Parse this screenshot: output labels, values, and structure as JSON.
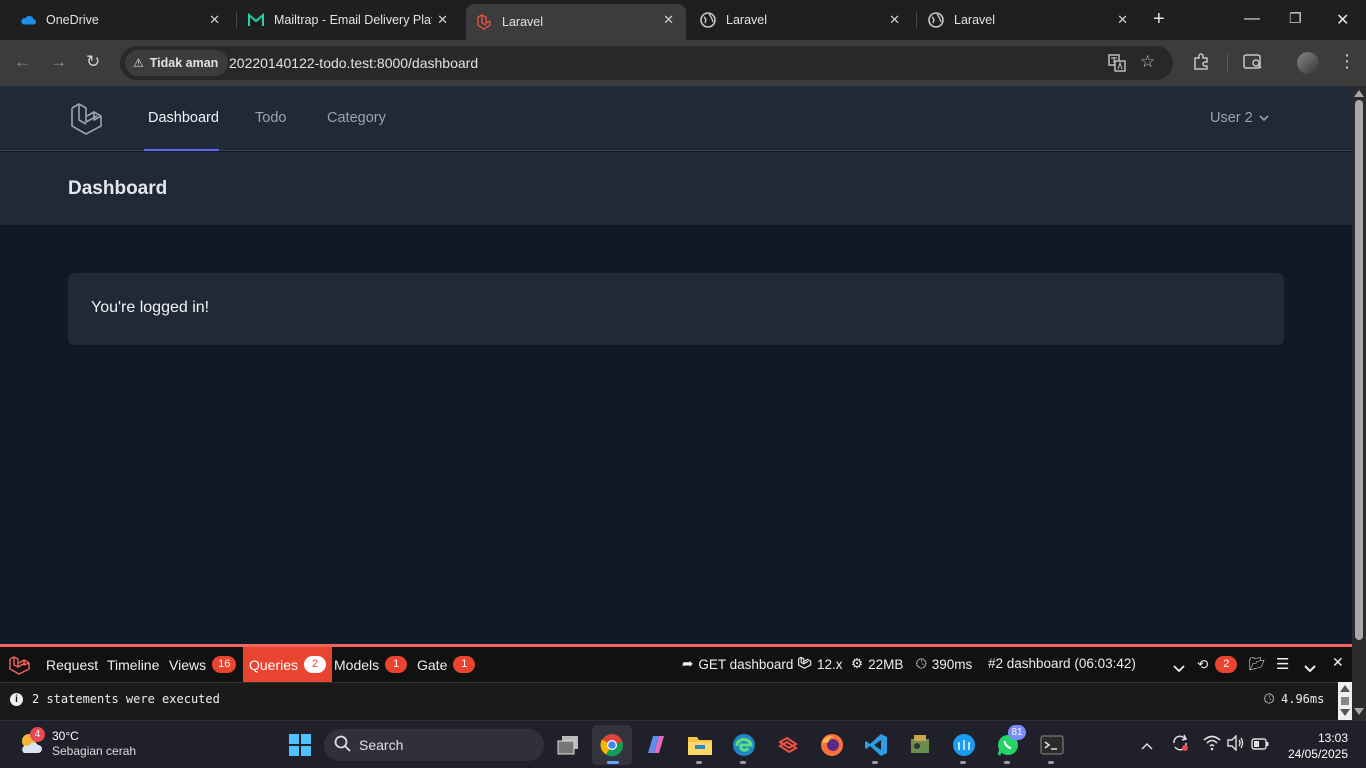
{
  "browser": {
    "tabs": [
      {
        "title": "OneDrive",
        "icon": "onedrive-icon"
      },
      {
        "title": "Mailtrap - Email Delivery Platf",
        "icon": "mailtrap-icon"
      },
      {
        "title": "Laravel",
        "icon": "laravel-icon",
        "active": true
      },
      {
        "title": "Laravel",
        "icon": "globe-icon"
      },
      {
        "title": "Laravel",
        "icon": "globe-icon"
      }
    ],
    "security_label": "Tidak aman",
    "url": "20220140122-todo.test:8000/dashboard"
  },
  "app": {
    "nav": {
      "dashboard": "Dashboard",
      "todo": "Todo",
      "category": "Category"
    },
    "user_menu": "User 2",
    "page_title": "Dashboard",
    "card_text": "You're logged in!"
  },
  "debugbar": {
    "tabs": {
      "request": "Request",
      "timeline": "Timeline",
      "views": "Views",
      "views_count": "16",
      "queries": "Queries",
      "queries_count": "2",
      "models": "Models",
      "models_count": "1",
      "gate": "Gate",
      "gate_count": "1"
    },
    "route": "GET dashboard",
    "laravel_version": "12.x",
    "memory": "22MB",
    "duration": "390ms",
    "request_id": "#2 dashboard (06:03:42)",
    "history_count": "2",
    "message": "2 statements were executed",
    "query_time": "4.96ms"
  },
  "taskbar": {
    "weather_badge": "4",
    "temperature": "30°C",
    "weather_desc": "Sebagian cerah",
    "search_label": "Search",
    "whatsapp_badge": "81",
    "time": "13:03",
    "date": "24/05/2025"
  },
  "colors": {
    "accent": "#6366f1",
    "debugbar_red": "#e9442f",
    "nav_bg": "#1f2937",
    "page_bg": "#111827"
  }
}
